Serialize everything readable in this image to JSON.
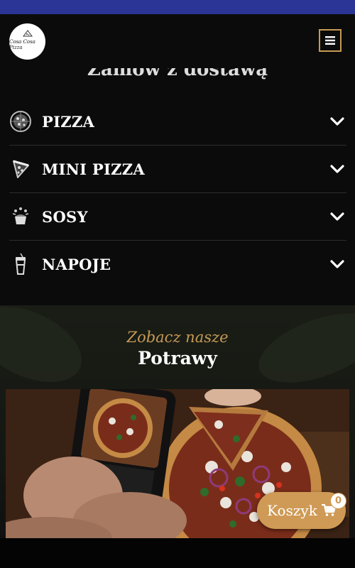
{
  "header": {
    "logo_text": "Cosa Cosa Pizza",
    "menu_icon": "hamburger-icon"
  },
  "order_section": {
    "title": "Zamów z dostawą",
    "categories": [
      {
        "label": "PIZZA",
        "icon": "pizza-icon"
      },
      {
        "label": "MINI PIZZA",
        "icon": "pizza-slice-icon"
      },
      {
        "label": "SOSY",
        "icon": "sauce-cup-icon"
      },
      {
        "label": "NAPOJE",
        "icon": "drink-cup-icon"
      }
    ]
  },
  "promo": {
    "eyebrow": "Zobacz nasze",
    "title": "Potrawy"
  },
  "cart": {
    "label": "Koszyk",
    "count": "0",
    "icon": "cart-icon"
  },
  "colors": {
    "accent": "#cf9a55",
    "background": "#0b0b0b",
    "status_bar": "#2b3595"
  }
}
